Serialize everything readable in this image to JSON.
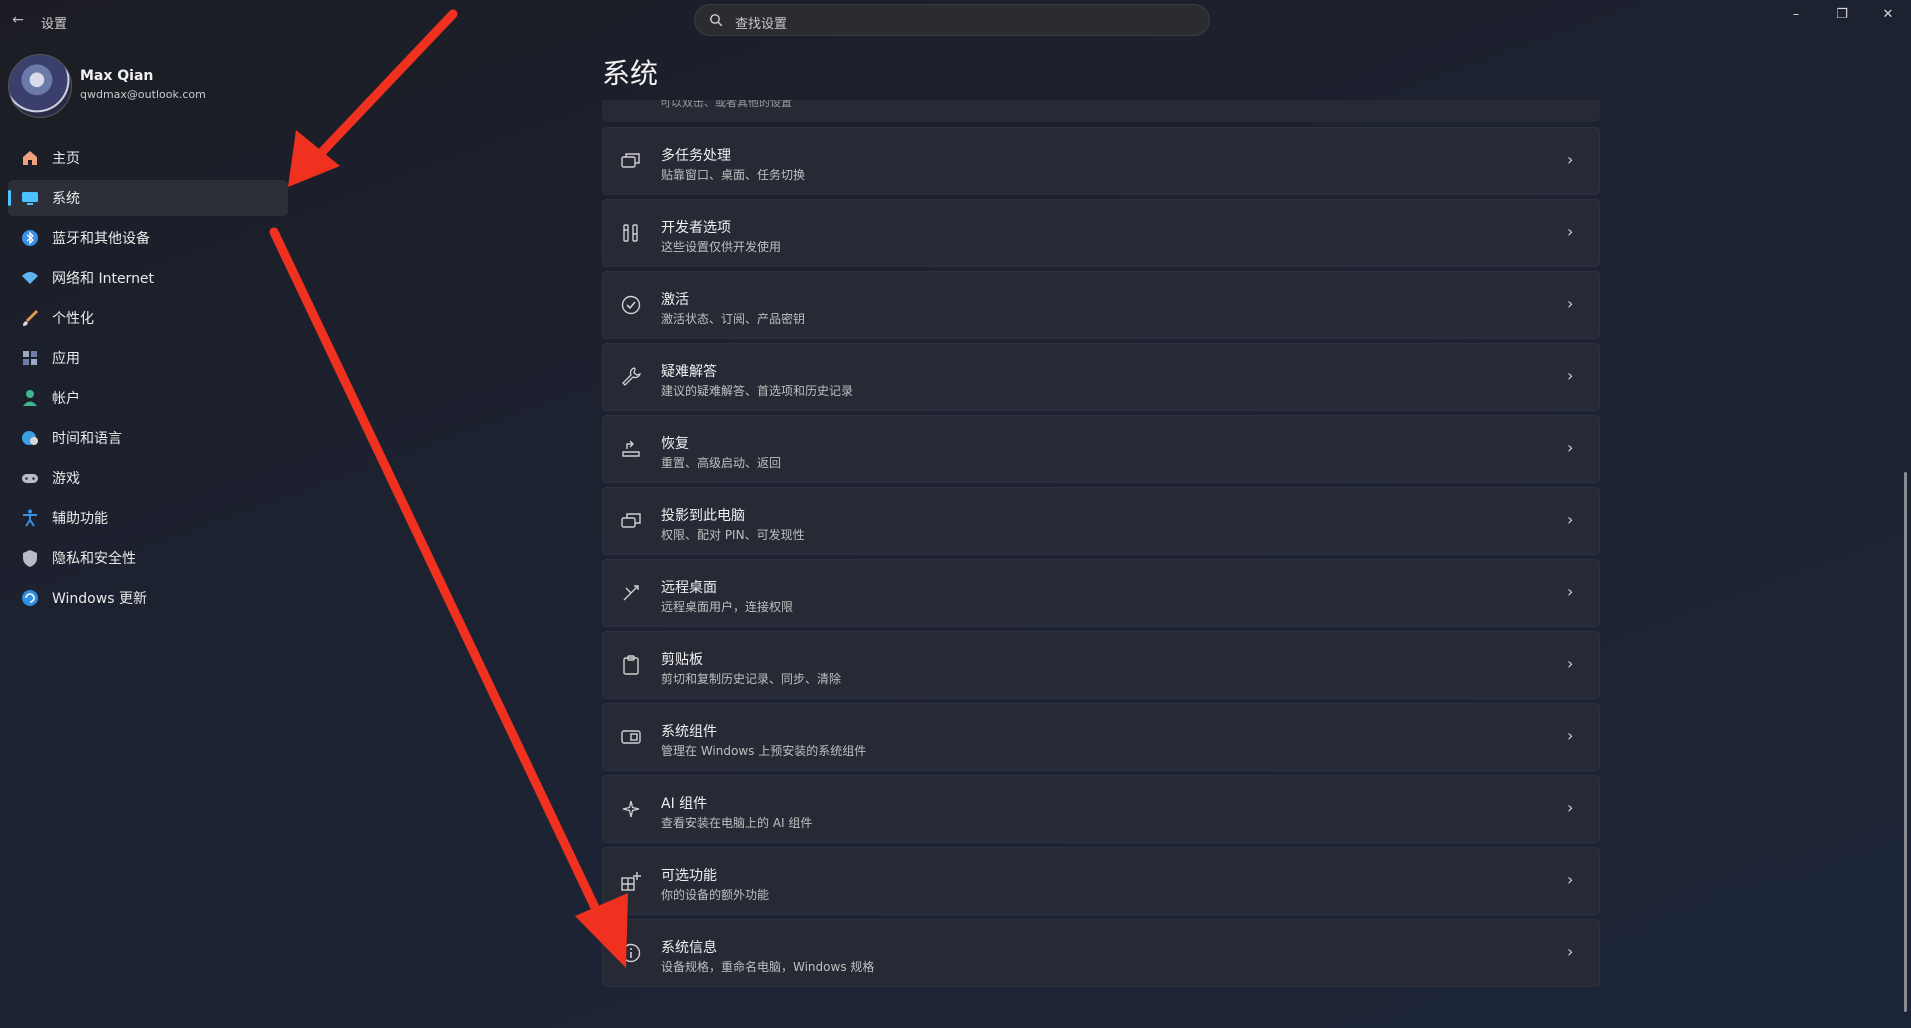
{
  "window": {
    "title": "设置",
    "back_glyph": "←",
    "controls": {
      "minimize": "–",
      "maximize": "❐",
      "close": "✕"
    }
  },
  "search": {
    "placeholder": "查找设置"
  },
  "profile": {
    "name": "Max Qian",
    "email": "qwdmax@outlook.com"
  },
  "sidebar": {
    "items": [
      {
        "label": "主页",
        "icon": "home-icon",
        "color": "#f0a07a"
      },
      {
        "label": "系统",
        "icon": "system-icon",
        "color": "#4cc2ff",
        "active": true
      },
      {
        "label": "蓝牙和其他设备",
        "icon": "bluetooth-icon",
        "color": "#3b8fe6"
      },
      {
        "label": "网络和 Internet",
        "icon": "wifi-icon",
        "color": "#5fb3f0"
      },
      {
        "label": "个性化",
        "icon": "brush-icon",
        "color": "#e39a4c"
      },
      {
        "label": "应用",
        "icon": "apps-icon",
        "color": "#9aa8c8"
      },
      {
        "label": "帐户",
        "icon": "account-icon",
        "color": "#3fb68b"
      },
      {
        "label": "时间和语言",
        "icon": "globe-clock-icon",
        "color": "#3e9fe0"
      },
      {
        "label": "游戏",
        "icon": "gamepad-icon",
        "color": "#b7bcc8"
      },
      {
        "label": "辅助功能",
        "icon": "accessibility-icon",
        "color": "#3b8fe6"
      },
      {
        "label": "隐私和安全性",
        "icon": "shield-icon",
        "color": "#b8bcc7"
      },
      {
        "label": "Windows 更新",
        "icon": "windows-update-icon",
        "color": "#2f8ee0"
      }
    ]
  },
  "main": {
    "title": "系统",
    "partial_top_text": "可以双击、或者其他的设置",
    "cards": [
      {
        "title": "多任务处理",
        "subtitle": "贴靠窗口、桌面、任务切换",
        "icon": "multitasking-icon"
      },
      {
        "title": "开发者选项",
        "subtitle": "这些设置仅供开发使用",
        "icon": "developer-tools-icon"
      },
      {
        "title": "激活",
        "subtitle": "激活状态、订阅、产品密钥",
        "icon": "check-circle-icon"
      },
      {
        "title": "疑难解答",
        "subtitle": "建议的疑难解答、首选项和历史记录",
        "icon": "wrench-icon"
      },
      {
        "title": "恢复",
        "subtitle": "重置、高级启动、返回",
        "icon": "recovery-icon"
      },
      {
        "title": "投影到此电脑",
        "subtitle": "权限、配对 PIN、可发现性",
        "icon": "project-icon"
      },
      {
        "title": "远程桌面",
        "subtitle": "远程桌面用户，连接权限",
        "icon": "remote-desktop-icon"
      },
      {
        "title": "剪贴板",
        "subtitle": "剪切和复制历史记录、同步、清除",
        "icon": "clipboard-icon"
      },
      {
        "title": "系统组件",
        "subtitle": "管理在 Windows 上预安装的系统组件",
        "icon": "system-components-icon"
      },
      {
        "title": "AI 组件",
        "subtitle": "查看安装在电脑上的 AI 组件",
        "icon": "ai-sparkle-icon"
      },
      {
        "title": "可选功能",
        "subtitle": "你的设备的额外功能",
        "icon": "optional-features-icon"
      },
      {
        "title": "系统信息",
        "subtitle": "设备规格，重命名电脑，Windows 规格",
        "icon": "info-icon"
      }
    ],
    "chevron": "›"
  },
  "annotations": {
    "arrow_color": "#f0311f"
  }
}
